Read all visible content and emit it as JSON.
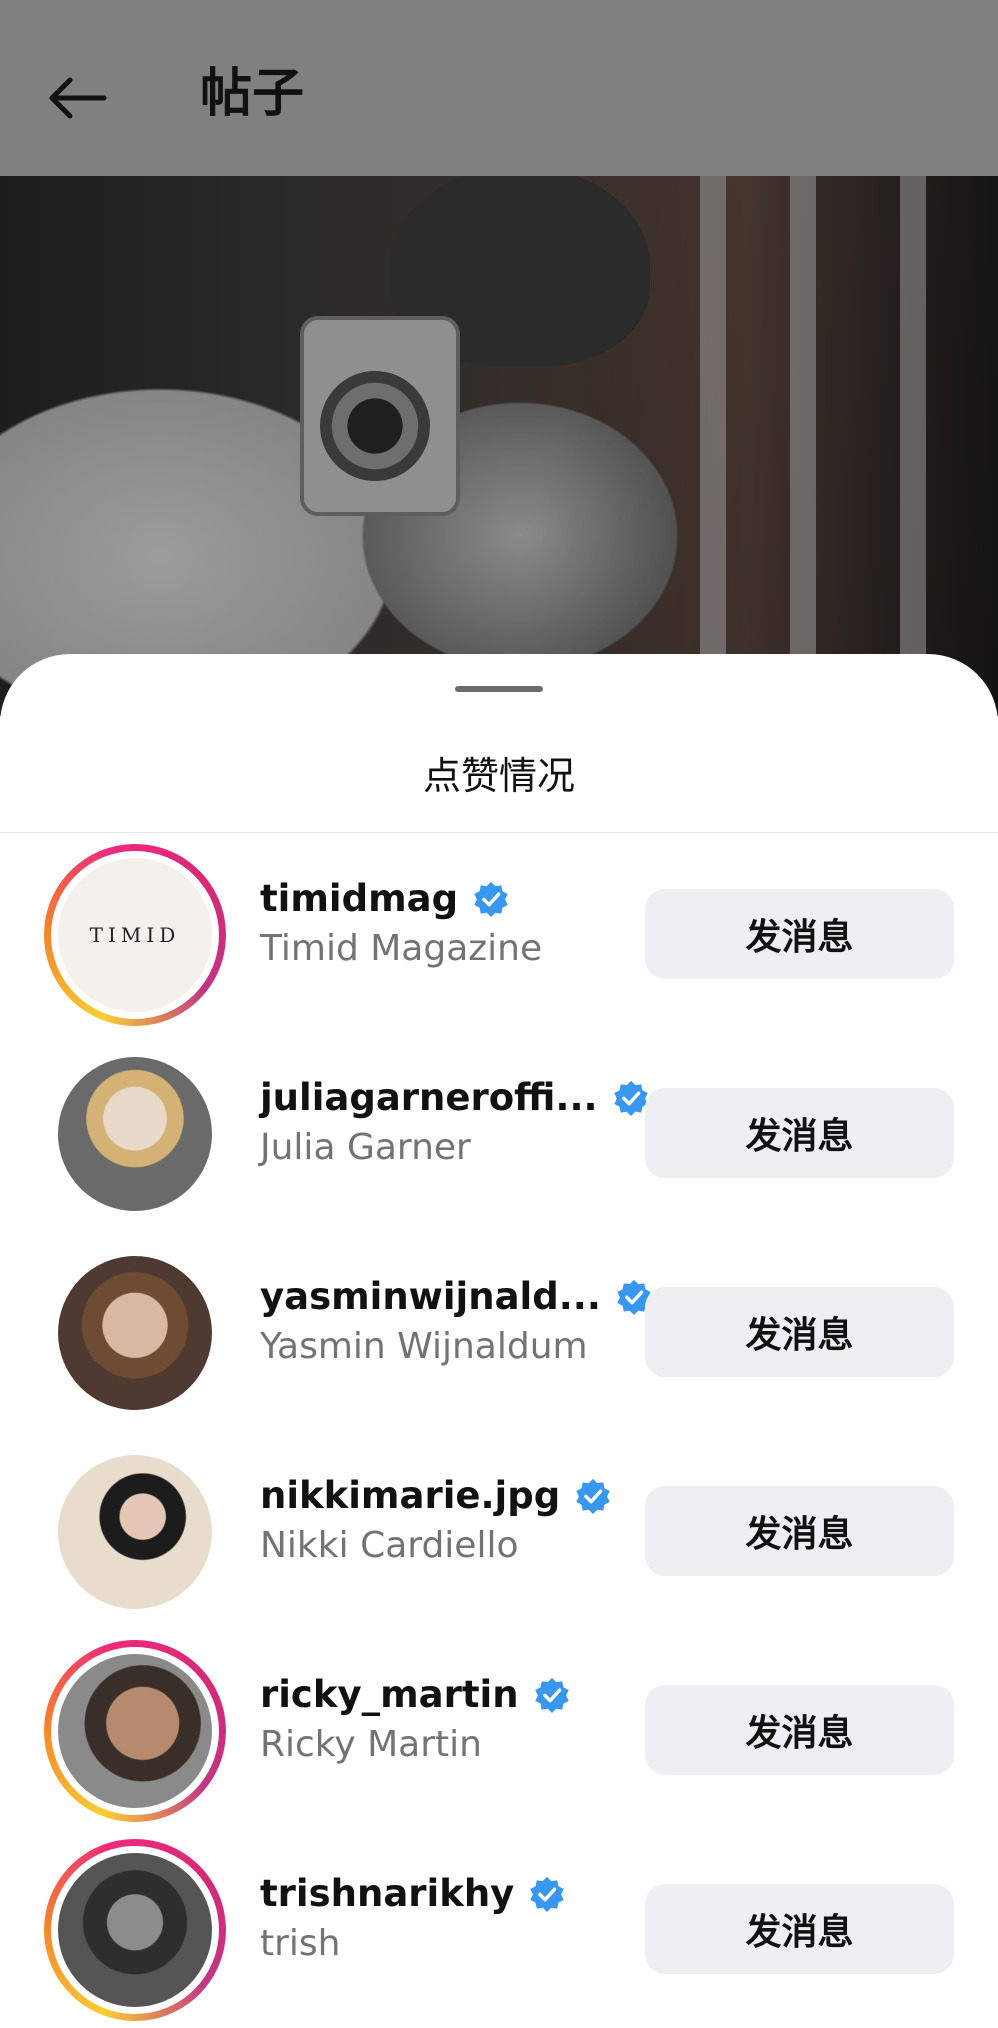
{
  "header": {
    "title": "帖子",
    "back_icon": "arrow-left-icon"
  },
  "post": {
    "image_alt": "post-photo"
  },
  "sheet": {
    "title": "点赞情况"
  },
  "colors": {
    "verified": "#3897f0",
    "button_bg": "#efeff3",
    "secondary_text": "#737373"
  },
  "likes": [
    {
      "username": "timidmag",
      "full_name": "Timid Magazine",
      "verified": true,
      "story_ring": true,
      "avatar_text": "TIMID",
      "button": "发消息"
    },
    {
      "username": "juliagarneroffi...",
      "full_name": "Julia Garner",
      "verified": true,
      "story_ring": false,
      "button": "发消息"
    },
    {
      "username": "yasminwijnald...",
      "full_name": "Yasmin Wijnaldum",
      "verified": true,
      "story_ring": false,
      "button": "发消息"
    },
    {
      "username": "nikkimarie.jpg",
      "full_name": "Nikki Cardiello",
      "verified": true,
      "story_ring": false,
      "button": "发消息"
    },
    {
      "username": "ricky_martin",
      "full_name": "Ricky Martin",
      "verified": true,
      "story_ring": true,
      "button": "发消息"
    },
    {
      "username": "trishnarikhy",
      "full_name": "trish",
      "verified": true,
      "story_ring": true,
      "button": "发消息"
    }
  ]
}
